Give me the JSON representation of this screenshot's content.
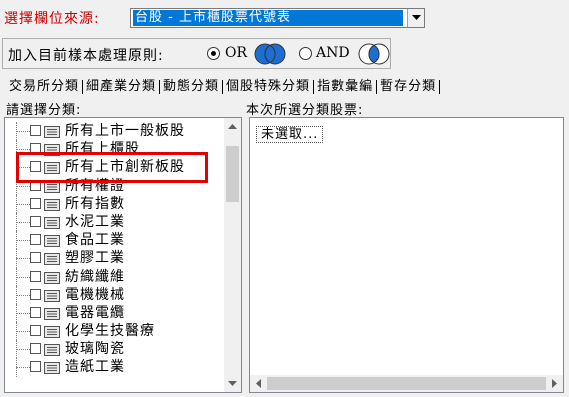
{
  "source": {
    "label": "選擇欄位來源:",
    "selected": "台股 - 上市櫃股票代號表"
  },
  "principle": {
    "label": "加入目前樣本處理原則:",
    "options": [
      {
        "label": "OR",
        "selected": true,
        "icon": "venn-or-icon"
      },
      {
        "label": "AND",
        "selected": false,
        "icon": "venn-and-icon"
      }
    ]
  },
  "tabs": [
    {
      "label": "交易所分類",
      "active": true
    },
    {
      "label": "細產業分類",
      "active": false
    },
    {
      "label": "動態分類",
      "active": false
    },
    {
      "label": "個股特殊分類",
      "active": false
    },
    {
      "label": "指數彙編",
      "active": false
    },
    {
      "label": "暫存分類",
      "active": false
    }
  ],
  "left_header": "請選擇分類:",
  "right_header": "本次所選分類股票:",
  "categories": [
    "所有上市一般板股",
    "所有上櫃股",
    "所有上市創新板股",
    "所有權證",
    "所有指數",
    "水泥工業",
    "食品工業",
    "塑膠工業",
    "紡織纖維",
    "電機機械",
    "電器電纜",
    "化學生技醫療",
    "玻璃陶瓷",
    "造紙工業"
  ],
  "highlighted_category": "所有上市創新板股",
  "selected_stocks": [
    "未選取..."
  ],
  "colors": {
    "label_red": "#cc0000",
    "selection_blue": "#0078d7",
    "highlight_red": "#e00000",
    "venn_blue": "#1c6fd0"
  }
}
